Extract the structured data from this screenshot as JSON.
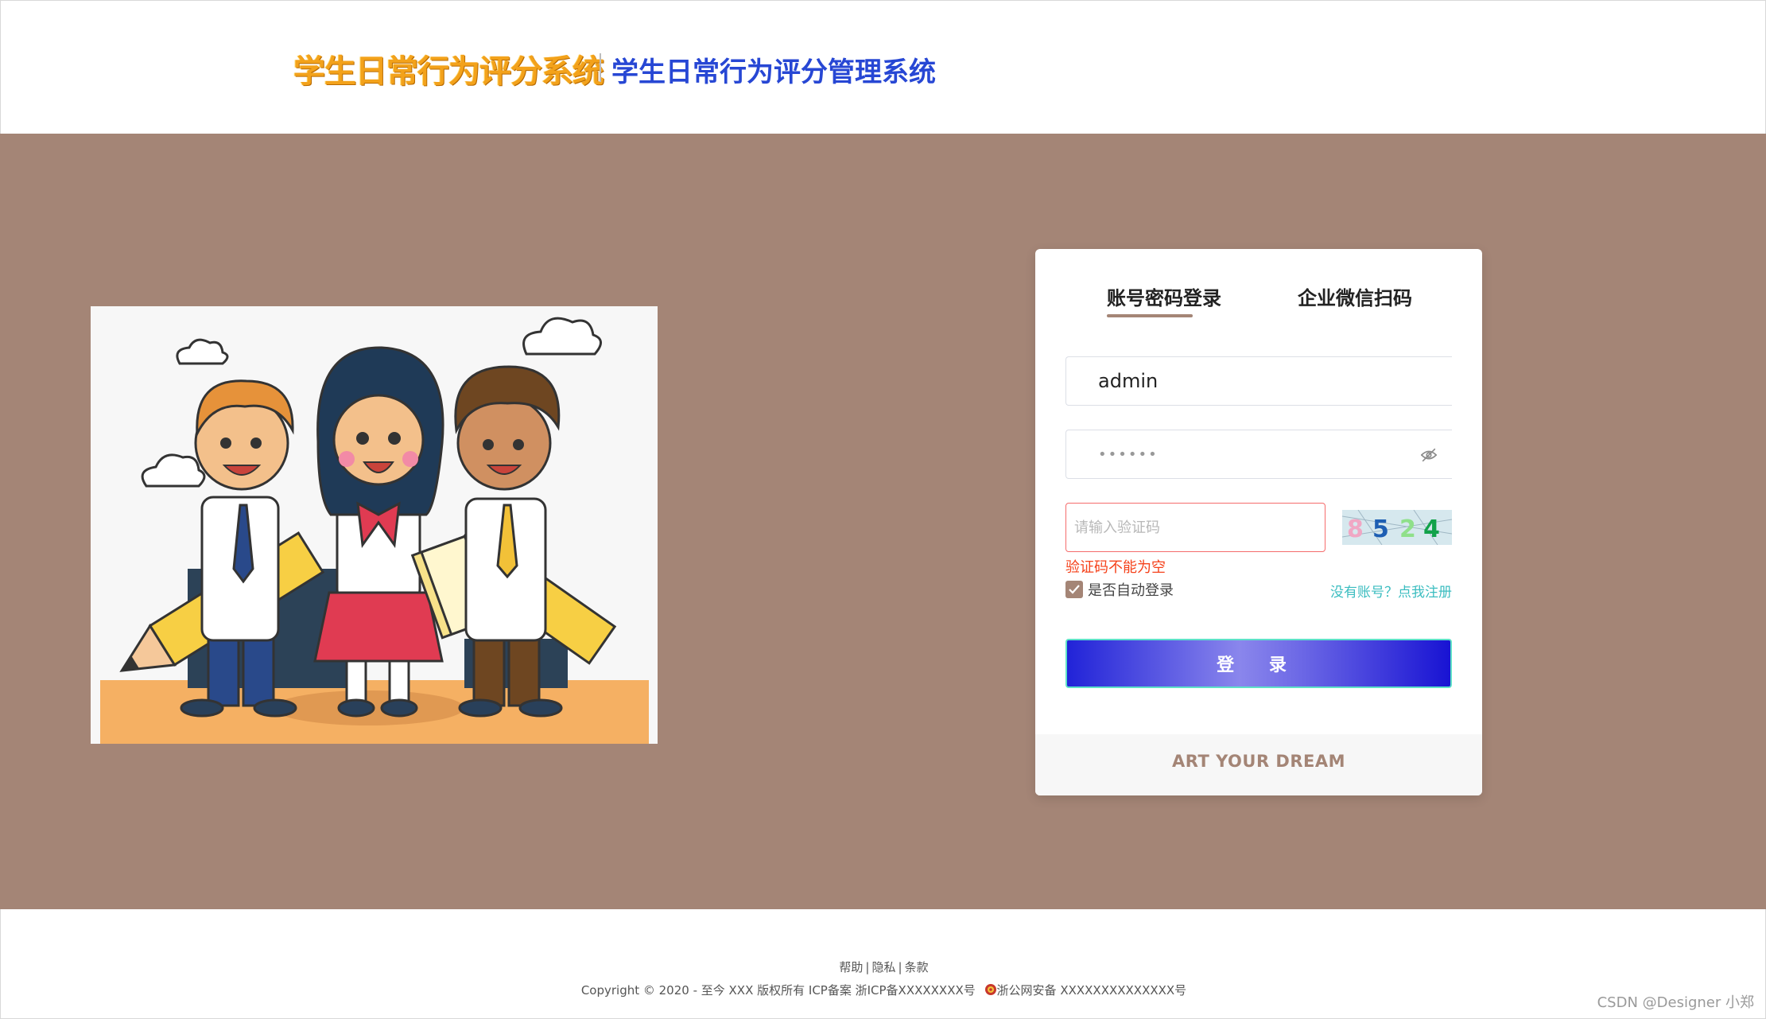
{
  "header": {
    "logo_text": "学生日常行为评分系统",
    "system_title": "学生日常行为评分管理系统"
  },
  "login": {
    "tabs": [
      "账号密码登录",
      "企业微信扫码"
    ],
    "active_tab": 0,
    "username_value": "admin",
    "password_value": "••••••",
    "captcha_placeholder": "请输入验证码",
    "captcha_code": "8524",
    "captcha_error": "验证码不能为空",
    "auto_login_label": "是否自动登录",
    "auto_login_checked": true,
    "register_link": "没有账号？点我注册",
    "submit_label": "登 录",
    "card_footer": "ART YOUR DREAM"
  },
  "footer": {
    "links": [
      "帮助",
      "隐私",
      "条款"
    ],
    "copyright": "Copyright © 2020 - 至今 XXX 版权所有 ICP备案 浙ICP备XXXXXXXX号",
    "police_record": "浙公网安备 XXXXXXXXXXXXXX号"
  },
  "watermark": "CSDN @Designer 小郑",
  "colors": {
    "main_bg": "#a48576",
    "accent": "#a48576",
    "title_blue": "#2747d4",
    "logo_orange": "#f3a21b",
    "error": "#f5421b",
    "link": "#3bbdc0"
  }
}
